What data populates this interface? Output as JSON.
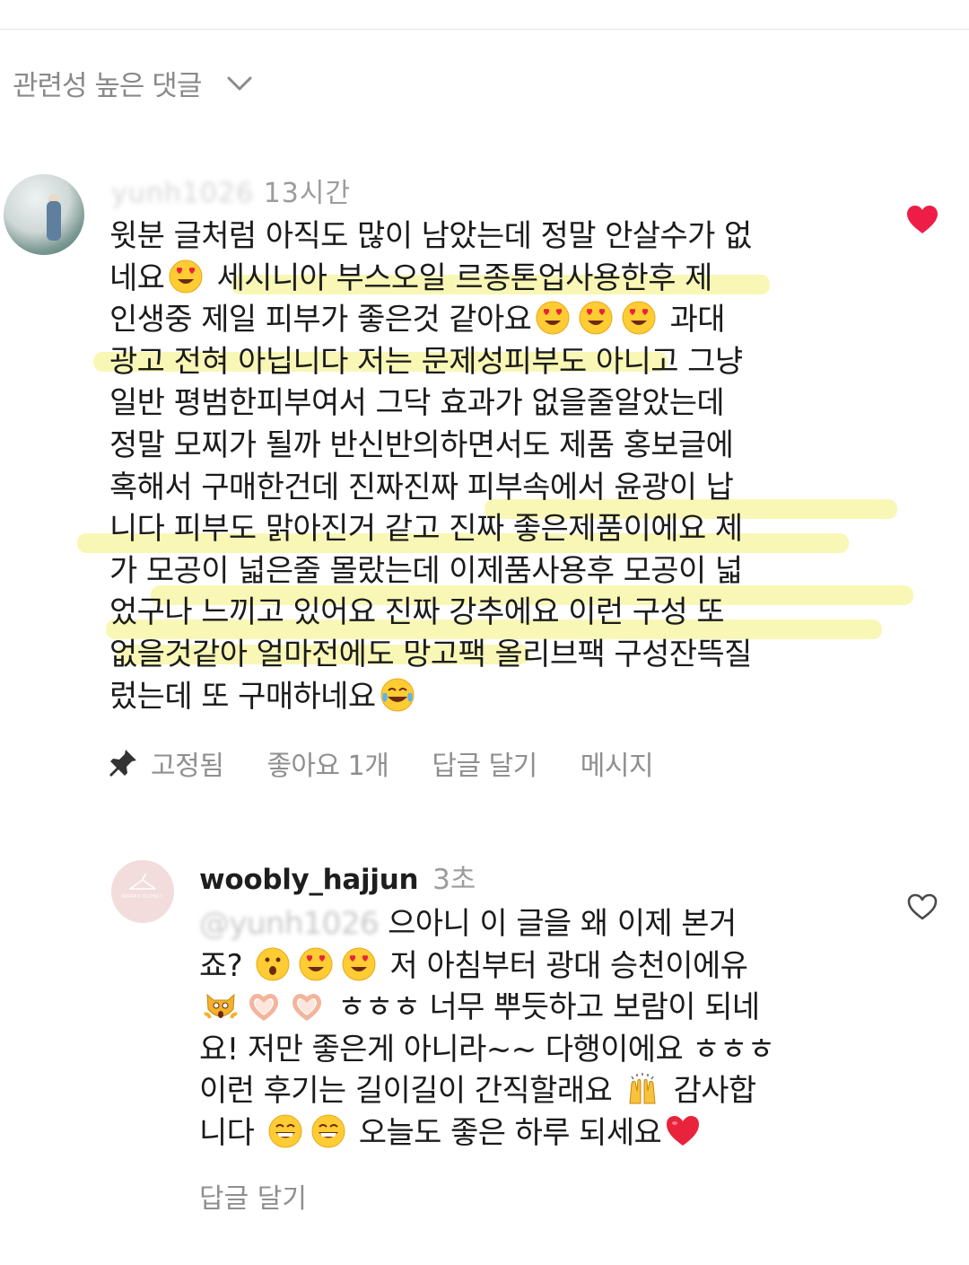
{
  "sort": {
    "label": "관련성 높은 댓글",
    "icon": "chevron-down-icon"
  },
  "comment1": {
    "time": "13시간",
    "lines": [
      [
        "윗분 글처럼 아직도 많이 남았는데 정말 안살수가 없"
      ],
      [
        "네요",
        "heart-eyes",
        " 세시니아 부스오일 르종톤업사용한후  제"
      ],
      [
        "인생중 제일 피부가 좋은것 같아요",
        "heart-eyes",
        "heart-eyes",
        "heart-eyes",
        " 과대"
      ],
      [
        "광고 전혀 아닙니다 저는 문제성피부도 아니고 그냥"
      ],
      [
        "일반 평범한피부여서 그닥 효과가 없을줄알았는데"
      ],
      [
        "정말 모찌가 될까 반신반의하면서도 제품 홍보글에"
      ],
      [
        "혹해서  구매한건데 진짜진짜 피부속에서 윤광이 납"
      ],
      [
        "니다 피부도 맑아진거 같고 진짜 좋은제품이에요  제"
      ],
      [
        "가 모공이 넓은줄 몰랐는데 이제품사용후 모공이 넓"
      ],
      [
        "었구나 느끼고 있어요 진짜 강추에요 이런 구성 또"
      ],
      [
        "없을것같아 얼마전에도 망고팩 올리브팩 구성잔뜩질"
      ],
      [
        "렀는데 또 구매하네요",
        "tears-of-joy"
      ]
    ],
    "actions": {
      "pinned": "고정됨",
      "likes": "좋아요 1개",
      "reply": "답글 달기",
      "message": "메시지"
    },
    "liked": true,
    "accent": "#ee1d48",
    "highlight_color": "#f4f07a"
  },
  "comment2": {
    "username": "woobly_hajjun",
    "time": "3초",
    "avatar_text": "MAMAS CLOSET",
    "lines": [
      [
        "@",
        " 으아니 이 글을 왜 이제 본거"
      ],
      [
        "죠? ",
        "astonished",
        "heart-eyes",
        "heart-eyes",
        " 저 아침부터 광대 승천이에유"
      ],
      [
        "scream-cat",
        "heart-hands",
        "heart-hands",
        " ㅎㅎㅎ 너무 뿌듯하고 보람이 되네"
      ],
      [
        "요! 저만 좋은게 아니라~~ 다행이에요 ㅎㅎㅎ"
      ],
      [
        "이런 후기는 길이길이 간직할래요 ",
        "raising-hands",
        " 감사합"
      ],
      [
        "니다 ",
        "grin",
        "grin",
        " 오늘도 좋은 하루 되세요",
        "red-heart"
      ]
    ],
    "reply": "답글 달기"
  }
}
